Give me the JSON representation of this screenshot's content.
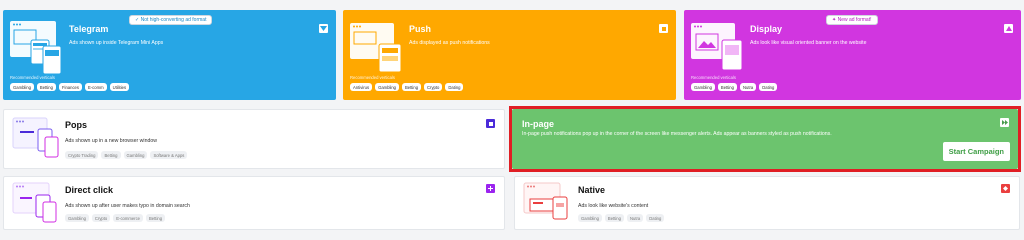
{
  "colors": {
    "telegram": "#27a6e5",
    "push": "#ffa800",
    "display": "#d136e0",
    "inpage": "#6cc46e",
    "pops_accent": "#4b2bd9",
    "direct_accent": "#9b24ef",
    "native_accent": "#ea3f3f",
    "highlight": "#e01e24"
  },
  "telegram": {
    "title": "Telegram",
    "description": "Ads shown up inside Telegram Mini Apps",
    "badge": "Not high-converting ad format",
    "recommended": "Recommended verticals",
    "tags": [
      "Gambling",
      "Betting",
      "Finances",
      "E-comm",
      "Utilities"
    ],
    "icon": "chevron-down-icon"
  },
  "push": {
    "title": "Push",
    "description": "Ads displayed as push notifications",
    "recommended": "Recommended verticals",
    "tags": [
      "Antivirus",
      "Gambling",
      "Betting",
      "Crypto",
      "Dating"
    ],
    "icon": "square-icon"
  },
  "display": {
    "title": "Display",
    "description": "Ads look like visual oriented banner on the website",
    "badge": "New ad format!",
    "recommended": "Recommended verticals",
    "tags": [
      "Gambling",
      "Betting",
      "Nutra",
      "Dating"
    ],
    "icon": "triangle-icon"
  },
  "pops": {
    "title": "Pops",
    "description": "Ads shown up in a new browser window",
    "tags": [
      "Crypto Trading",
      "Betting",
      "Gambling",
      "Software & Apps"
    ],
    "icon": "square-icon"
  },
  "inpage": {
    "title": "In-page",
    "description": "In-page push notifications pop up in the corner of the screen like messenger alerts. Ads appear as banners styled as push notifications.",
    "button": "Start Campaign",
    "icon": "fast-forward-icon"
  },
  "direct": {
    "title": "Direct click",
    "description": "Ads shown up after user makes typo in domain search",
    "tags": [
      "Gambling",
      "Crypto",
      "E-commerce",
      "Betting"
    ],
    "icon": "plus-icon"
  },
  "native": {
    "title": "Native",
    "description": "Ads look like website's content",
    "tags": [
      "Gambling",
      "Betting",
      "Nutra",
      "Dating"
    ],
    "icon": "diamond-icon"
  }
}
